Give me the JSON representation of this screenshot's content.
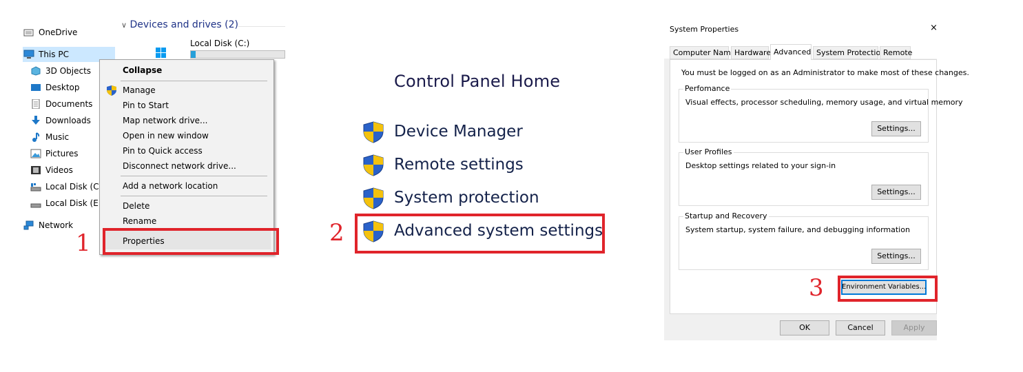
{
  "explorer": {
    "nav_items": [
      {
        "label": "OneDrive",
        "icon": "onedrive-icon"
      },
      {
        "label": "This PC",
        "icon": "this-pc-icon"
      },
      {
        "label": "3D Objects",
        "icon": "3d-objects-icon"
      },
      {
        "label": "Desktop",
        "icon": "desktop-icon"
      },
      {
        "label": "Documents",
        "icon": "documents-icon"
      },
      {
        "label": "Downloads",
        "icon": "downloads-icon"
      },
      {
        "label": "Music",
        "icon": "music-icon"
      },
      {
        "label": "Pictures",
        "icon": "pictures-icon"
      },
      {
        "label": "Videos",
        "icon": "videos-icon"
      },
      {
        "label": "Local Disk (C:)",
        "icon": "drive-icon"
      },
      {
        "label": "Local Disk (E:)",
        "icon": "drive-icon"
      },
      {
        "label": "Network",
        "icon": "network-icon"
      }
    ],
    "group_header": "Devices and drives (2)",
    "drive_label": "Local Disk (C:)",
    "drive_usage_fraction": 0.05
  },
  "context_menu": {
    "items": [
      "Collapse",
      "Manage",
      "Pin to Start",
      "Map network drive...",
      "Open in new window",
      "Pin to Quick access",
      "Disconnect network drive...",
      "Add a network location",
      "Delete",
      "Rename",
      "Properties"
    ]
  },
  "steps": [
    "1",
    "2",
    "3"
  ],
  "control_panel": {
    "home": "Control Panel Home",
    "links": [
      "Device Manager",
      "Remote settings",
      "System protection",
      "Advanced system settings"
    ]
  },
  "system_properties": {
    "title": "System Properties",
    "close": "×",
    "tabs": [
      "Computer Name",
      "Hardware",
      "Advanced",
      "System Protection",
      "Remote"
    ],
    "admin_note": "You must be logged on as an Administrator to make most of these changes.",
    "groups": [
      {
        "title": "Perfomance",
        "text": "Visual effects, processor scheduling, memory usage, and virtual memory",
        "button": "Settings..."
      },
      {
        "title": "User Profiles",
        "text": "Desktop settings related to your sign-in",
        "button": "Settings..."
      },
      {
        "title": "Startup and Recovery",
        "text": "System startup, system failure, and debugging information",
        "button": "Settings..."
      }
    ],
    "env_button": "Environment Variables...",
    "ok": "OK",
    "cancel": "Cancel",
    "apply": "Apply"
  },
  "colors": {
    "highlight": "#e0242b",
    "selection": "#cce8ff",
    "link": "#1e3287"
  }
}
